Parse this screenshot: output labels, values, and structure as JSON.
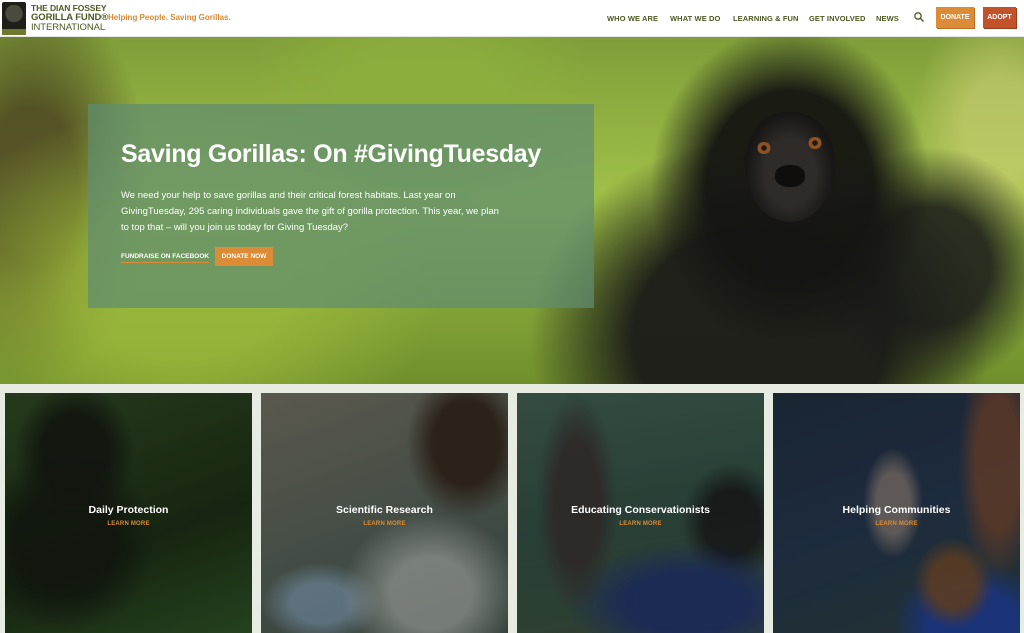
{
  "header": {
    "logo_lines": [
      "THE DIAN FOSSEY",
      "GORILLA FUND®",
      "INTERNATIONAL"
    ],
    "tagline": "Helping People. Saving Gorillas.",
    "nav": [
      "WHO WE ARE",
      "WHAT WE DO",
      "LEARNING & FUN",
      "GET INVOLVED",
      "NEWS"
    ],
    "search_icon": "search-icon",
    "donate_label": "DONATE",
    "adopt_label": "ADOPT"
  },
  "hero": {
    "title": "Saving Gorillas: On #GivingTuesday",
    "text": "We need your help to save gorillas and their critical forest habitats. Last year on GivingTuesday, 295 caring individuals gave the gift of gorilla protection. This year, we plan to top that – will you join us today for Giving Tuesday?",
    "fb_link": "FUNDRAISE ON FACEBOOK",
    "donate_label": "DONATE NOW"
  },
  "cards": [
    {
      "title": "Daily Protection",
      "link": "LEARN MORE"
    },
    {
      "title": "Scientific Research",
      "link": "LEARN MORE"
    },
    {
      "title": "Educating Conservationists",
      "link": "LEARN MORE"
    },
    {
      "title": "Helping Communities",
      "link": "LEARN MORE"
    }
  ],
  "colors": {
    "brand_green": "#4c5a22",
    "accent_orange": "#dc8b36",
    "adopt_red": "#c2522a",
    "panel_green": "#5f8c70"
  }
}
